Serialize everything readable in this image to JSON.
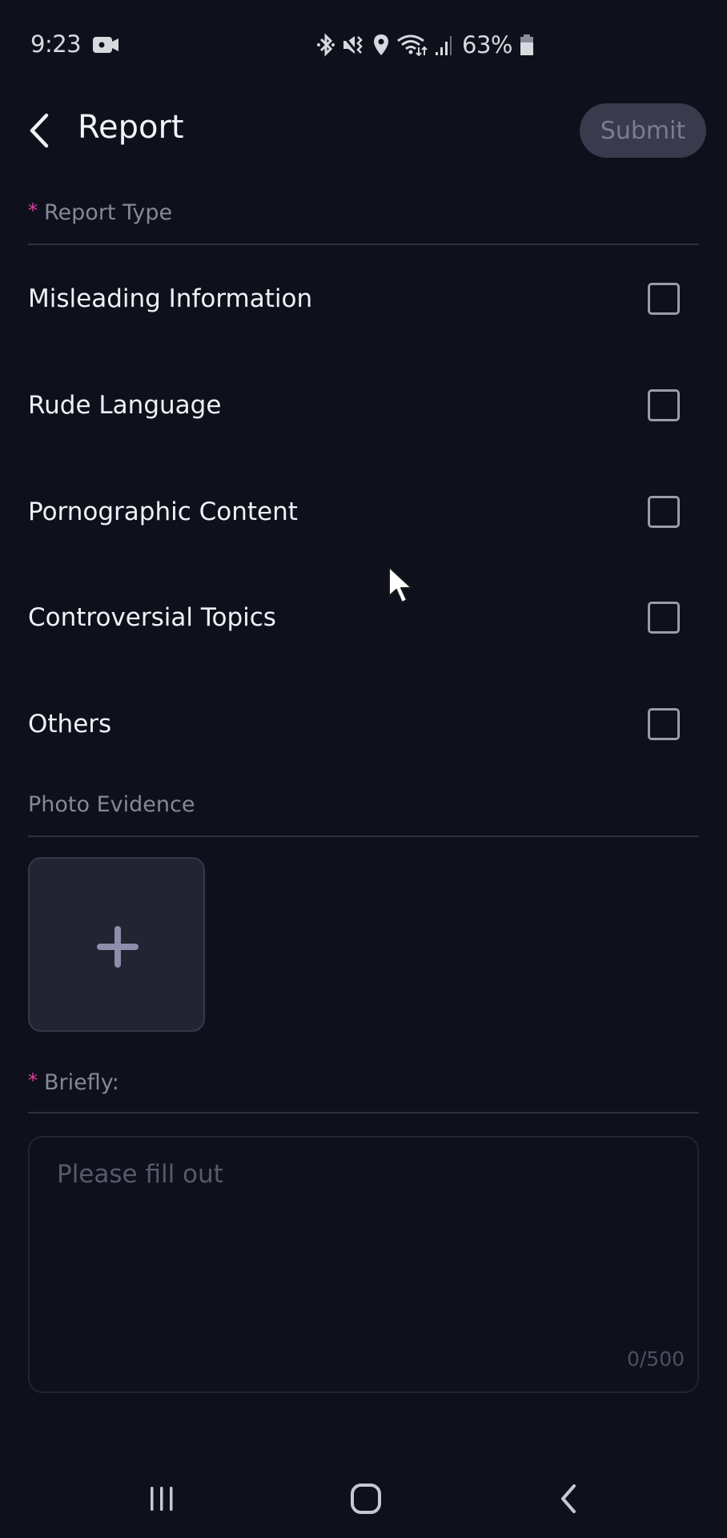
{
  "status_bar": {
    "time": "9:23",
    "battery_percent": "63%",
    "icons": [
      "video-record-icon",
      "bluetooth-icon",
      "vibrate-icon",
      "location-icon",
      "wifi-icon",
      "signal-icon",
      "battery-icon"
    ]
  },
  "header": {
    "title": "Report",
    "back_icon": "chevron-left-icon",
    "submit_label": "Submit",
    "submit_enabled": false
  },
  "report_type": {
    "required_marker": "*",
    "label": "Report Type",
    "options": [
      {
        "label": "Misleading Information",
        "checked": false
      },
      {
        "label": "Rude Language",
        "checked": false
      },
      {
        "label": "Pornographic Content",
        "checked": false
      },
      {
        "label": "Controversial Topics",
        "checked": false
      },
      {
        "label": "Others",
        "checked": false
      }
    ]
  },
  "photo_evidence": {
    "label": "Photo Evidence",
    "add_icon": "plus-icon"
  },
  "briefly": {
    "required_marker": "*",
    "label": "Briefly:",
    "value": "",
    "placeholder": "Please fill out",
    "counter": "0/500"
  },
  "nav_bar": {
    "buttons": [
      "recents-icon",
      "home-icon",
      "back-icon"
    ]
  },
  "colors": {
    "background": "#0e111c",
    "required_asterisk": "#e040a0",
    "submit_bg": "#393a4c",
    "submit_text": "#7b7d8f",
    "checkbox_border": "#9a9cab"
  }
}
